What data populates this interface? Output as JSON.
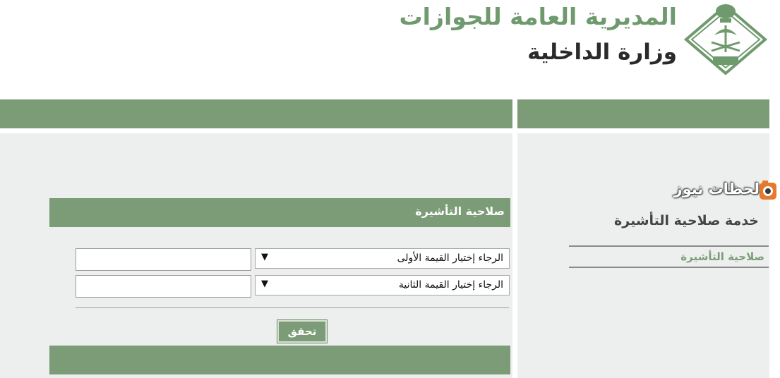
{
  "header": {
    "title": "المديرية العامة للجوازات",
    "subtitle": "وزارة الداخلية",
    "emblem_icon": "passport-directorate-emblem"
  },
  "form": {
    "section_title": "صلاحية التأشيرة",
    "select_first": "الرجاء إختيار القيمة الأولى",
    "select_second": "الرجاء إختيار القيمة الثانية",
    "input_first_value": "",
    "input_second_value": "",
    "submit_label": "تحقق"
  },
  "sidebar": {
    "watermark_text": "لحظات نيوز",
    "heading": "خدمة صلاحية التأشيرة",
    "link_label": "صلاحية التأشيرة"
  },
  "colors": {
    "brand_green": "#7b9c76",
    "panel_bg": "#edefef",
    "title_green": "#6f9a6e"
  }
}
